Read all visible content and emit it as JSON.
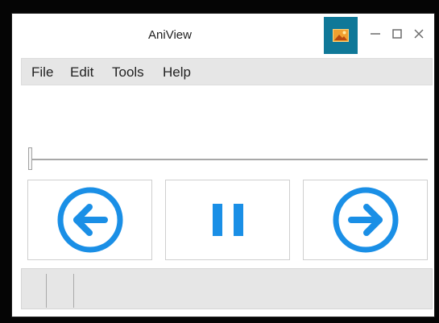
{
  "window": {
    "title": "AniView"
  },
  "titlebar": {
    "app_icon": "image-icon",
    "buttons": [
      "minimize-icon",
      "maximize-icon",
      "close-icon"
    ]
  },
  "menu": {
    "items": [
      {
        "label": "File"
      },
      {
        "label": "Edit"
      },
      {
        "label": "Tools"
      },
      {
        "label": "Help"
      }
    ]
  },
  "playback": {
    "position": 0,
    "controls": [
      "arrow-left-circle-icon",
      "pause-icon",
      "arrow-right-circle-icon"
    ]
  },
  "colors": {
    "accent": "#1a8fe6",
    "app_icon_bg": "#0f7898",
    "menu_bg": "#e6e6e6"
  }
}
